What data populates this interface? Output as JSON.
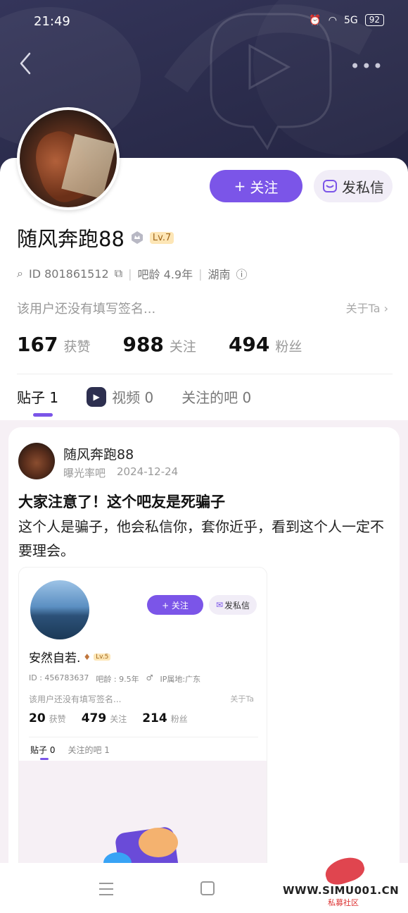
{
  "status": {
    "time": "21:49",
    "battery": "92",
    "signal": "5G"
  },
  "header": {
    "more": "•••"
  },
  "profile": {
    "username": "随风奔跑88",
    "level": "Lv.7",
    "follow_label": "关注",
    "message_label": "发私信",
    "id_text": "ID 801861512",
    "bar_age": "吧龄 4.9年",
    "location": "湖南",
    "signature": "该用户还没有填写签名...",
    "about": "关于Ta"
  },
  "stats": [
    {
      "num": "167",
      "label": "获赞"
    },
    {
      "num": "988",
      "label": "关注"
    },
    {
      "num": "494",
      "label": "粉丝"
    }
  ],
  "tabs": {
    "posts": "贴子 1",
    "videos": "视频 0",
    "bars": "关注的吧 0"
  },
  "post": {
    "author": "随风奔跑88",
    "bar": "曝光率吧",
    "date": "2024-12-24",
    "title": "大家注意了！这个吧友是死骗子",
    "body": "这个人是骗子，他会私信你，套你近乎，看到这个人一定不要理会。"
  },
  "screenshot": {
    "follow_label": "+ 关注",
    "message_label": "发私信",
    "username": "安然自若.",
    "level": "Lv.5",
    "id_text": "ID : 456783637",
    "bar_age": "吧龄 : 9.5年",
    "gender": "♂",
    "ip": "IP属地:广东",
    "signature": "该用户还没有填写签名...",
    "about": "关于Ta",
    "stats": [
      {
        "num": "20",
        "label": "获赞"
      },
      {
        "num": "479",
        "label": "关注"
      },
      {
        "num": "214",
        "label": "粉丝"
      }
    ],
    "tabs": {
      "posts": "贴子 0",
      "bars": "关注的吧 1"
    }
  },
  "watermark": {
    "site": "WWW.SIMU001.CN",
    "cn": "私募社区"
  },
  "colors": {
    "accent": "#7b55e8",
    "hero": "#2b2c4c"
  }
}
